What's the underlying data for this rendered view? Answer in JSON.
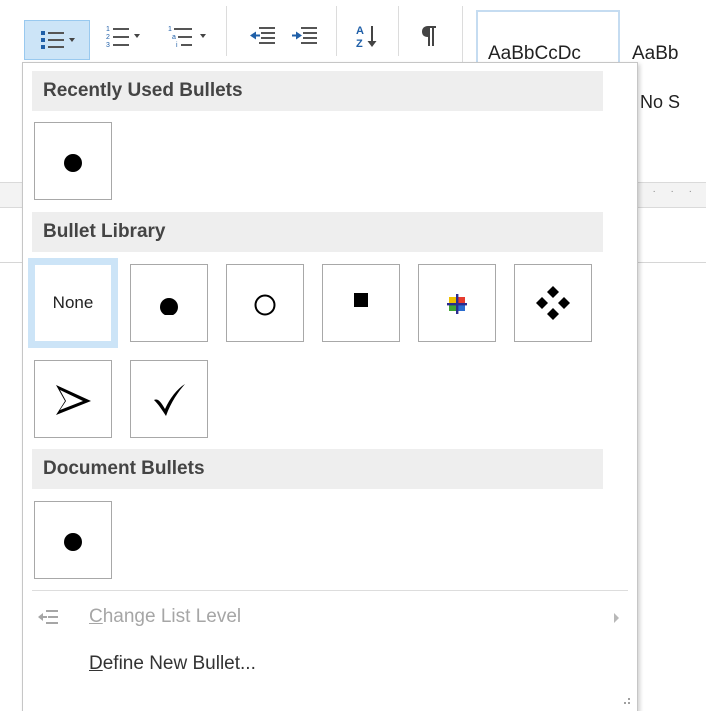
{
  "ribbon": {
    "style_preview_1": "AaBbCcDc",
    "style_preview_2": "AaBb",
    "style_name_2_partial": "No S",
    "tools": [
      "bullets-icon",
      "numbering-icon",
      "multilevel-list-icon",
      "decrease-indent-icon",
      "increase-indent-icon",
      "sort-icon",
      "show-formatting-marks-icon"
    ]
  },
  "panel": {
    "recently_used_header": "Recently Used Bullets",
    "bullet_library_header": "Bullet Library",
    "document_bullets_header": "Document Bullets",
    "none_label": "None",
    "recent_bullets": [
      "solid-circle"
    ],
    "library": [
      "none",
      "solid-circle",
      "hollow-circle",
      "solid-square",
      "colored-cross",
      "four-diamonds",
      "arrowhead",
      "checkmark"
    ],
    "document_bullets": [
      "solid-circle"
    ],
    "selected": "none",
    "change_list_level": {
      "accel": "C",
      "rest": "hange List Level",
      "enabled": false
    },
    "define_new_bullet": {
      "accel": "D",
      "rest": "efine New Bullet..."
    }
  },
  "colors": {
    "accent_selection": "#cce4f7",
    "header_bg": "#eeeeee",
    "disabled_text": "#a6a6a6"
  }
}
